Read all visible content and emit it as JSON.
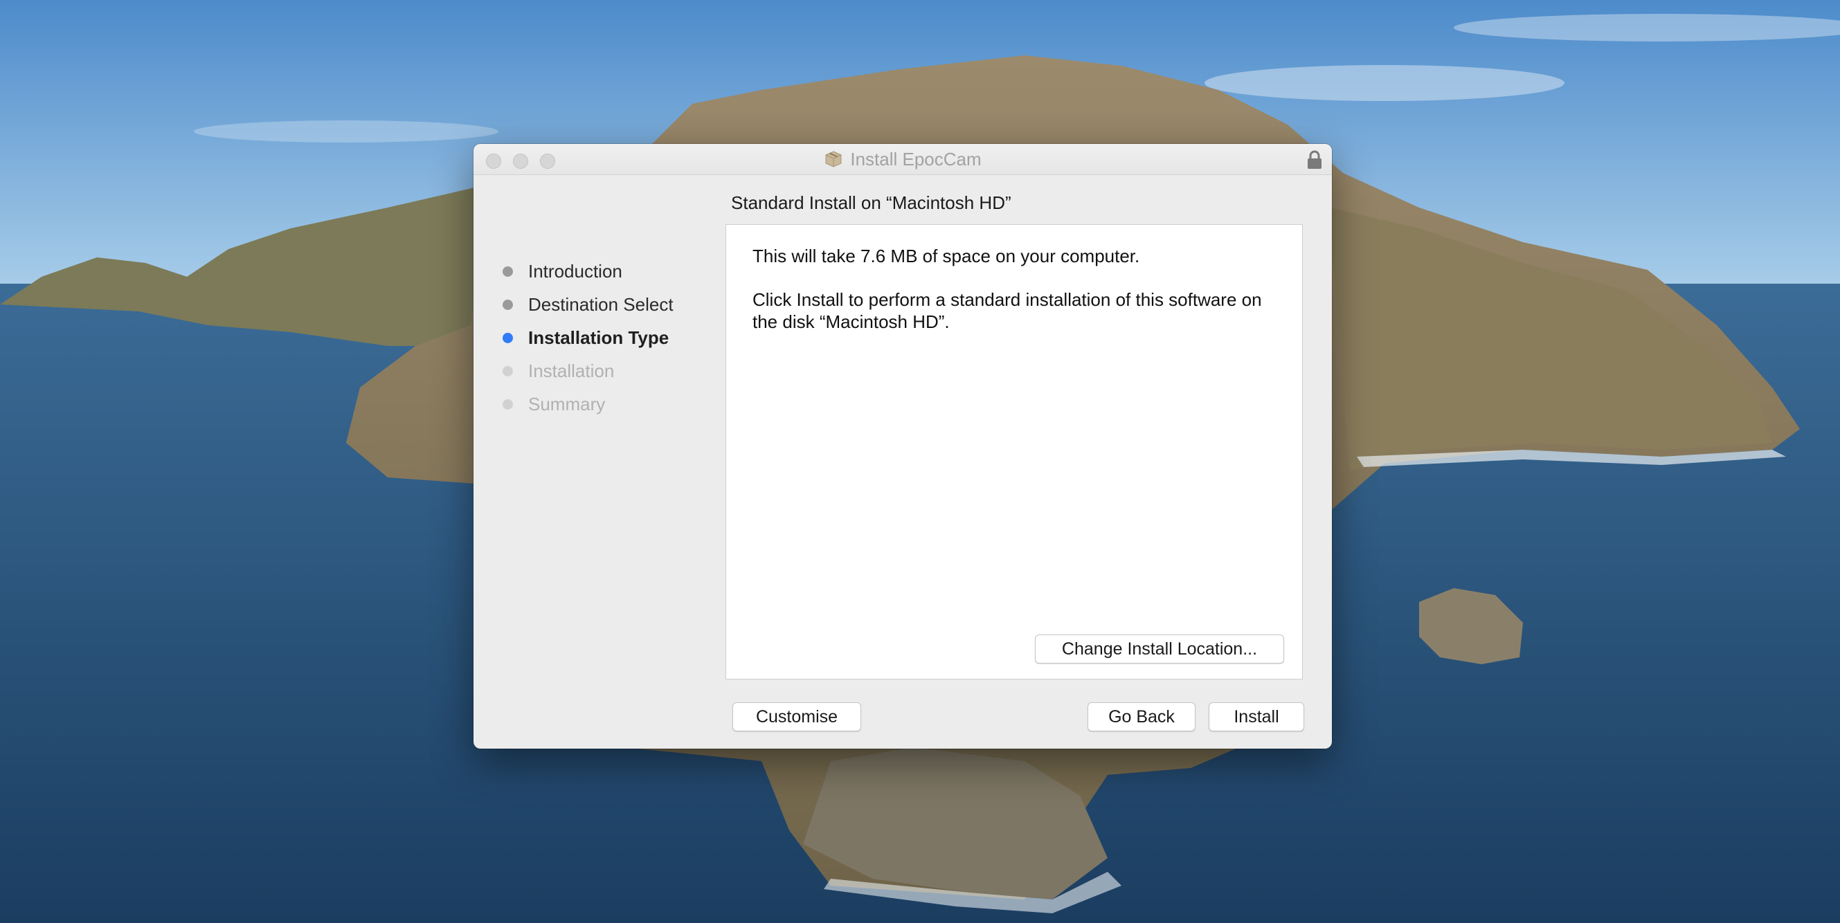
{
  "window": {
    "title": "Install EpocCam",
    "subtitle": "Standard Install on “Macintosh HD”"
  },
  "steps": [
    {
      "label": "Introduction",
      "state": "done"
    },
    {
      "label": "Destination Select",
      "state": "done"
    },
    {
      "label": "Installation Type",
      "state": "current"
    },
    {
      "label": "Installation",
      "state": "future"
    },
    {
      "label": "Summary",
      "state": "future"
    }
  ],
  "content": {
    "space_text": "This will take 7.6 MB of space on your computer.",
    "install_text": "Click Install to perform a standard installation of this software on the disk “Macintosh HD”."
  },
  "buttons": {
    "change_location": "Change Install Location...",
    "customise": "Customise",
    "go_back": "Go Back",
    "install": "Install"
  },
  "colors": {
    "current_step_dot": "#2f7cf6",
    "done_step_dot": "#9a9a9a",
    "future_step_dot": "#d1d1d1"
  },
  "icons": {
    "title": "package-icon",
    "lock": "lock-icon"
  }
}
